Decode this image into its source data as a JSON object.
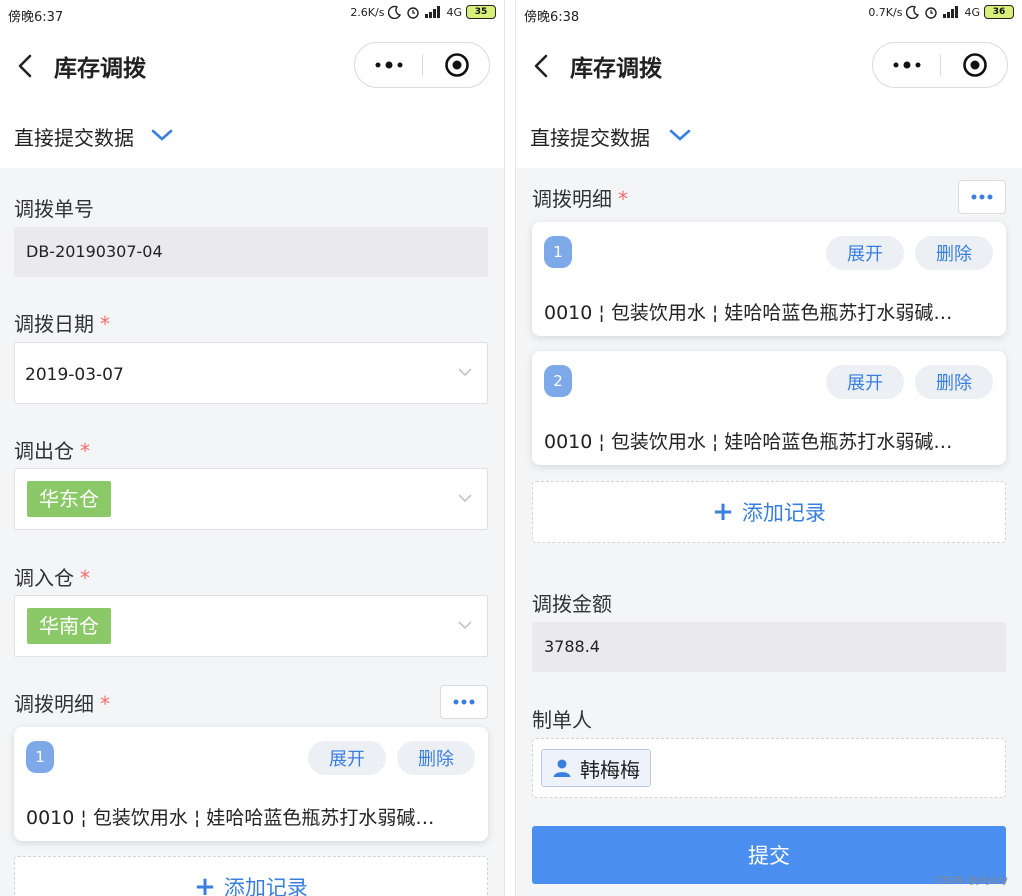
{
  "left": {
    "status": {
      "time": "傍晚6:37",
      "speed": "2.6K/s",
      "network": "4G",
      "battery": "35"
    },
    "nav": {
      "title": "库存调拨"
    },
    "mode": {
      "label": "直接提交数据"
    },
    "fields": {
      "order_no": {
        "label": "调拨单号",
        "value": "DB-20190307-04"
      },
      "date": {
        "label": "调拨日期",
        "required": "*",
        "value": "2019-03-07"
      },
      "out_warehouse": {
        "label": "调出仓",
        "required": "*",
        "value": "华东仓"
      },
      "in_warehouse": {
        "label": "调入仓",
        "required": "*",
        "value": "华南仓"
      },
      "details": {
        "label": "调拨明细",
        "required": "*"
      }
    },
    "items": [
      {
        "index": "1",
        "expand": "展开",
        "delete": "删除",
        "text": "0010 ¦ 包装饮用水 ¦ 娃哈哈蓝色瓶苏打水弱碱…"
      }
    ],
    "add_record": "添加记录"
  },
  "right": {
    "status": {
      "time": "傍晚6:38",
      "speed": "0.7K/s",
      "network": "4G",
      "battery": "36"
    },
    "nav": {
      "title": "库存调拨"
    },
    "mode": {
      "label": "直接提交数据"
    },
    "details": {
      "label": "调拨明细",
      "required": "*"
    },
    "items": [
      {
        "index": "1",
        "expand": "展开",
        "delete": "删除",
        "text": "0010 ¦ 包装饮用水 ¦ 娃哈哈蓝色瓶苏打水弱碱…"
      },
      {
        "index": "2",
        "expand": "展开",
        "delete": "删除",
        "text": "0010 ¦ 包装饮用水 ¦ 娃哈哈蓝色瓶苏打水弱碱…"
      }
    ],
    "add_record": "添加记录",
    "amount": {
      "label": "调拨金额",
      "value": "3788.4"
    },
    "creator": {
      "label": "制单人",
      "name": "韩梅梅"
    },
    "submit": "提交"
  },
  "watermark": "CSDN @jdyzzy",
  "colors": {
    "primary": "#4a8ef0",
    "link": "#3a7fe0",
    "tag_green": "#8bc867",
    "required": "#f56c6c",
    "badge": "#7ea9e8"
  }
}
